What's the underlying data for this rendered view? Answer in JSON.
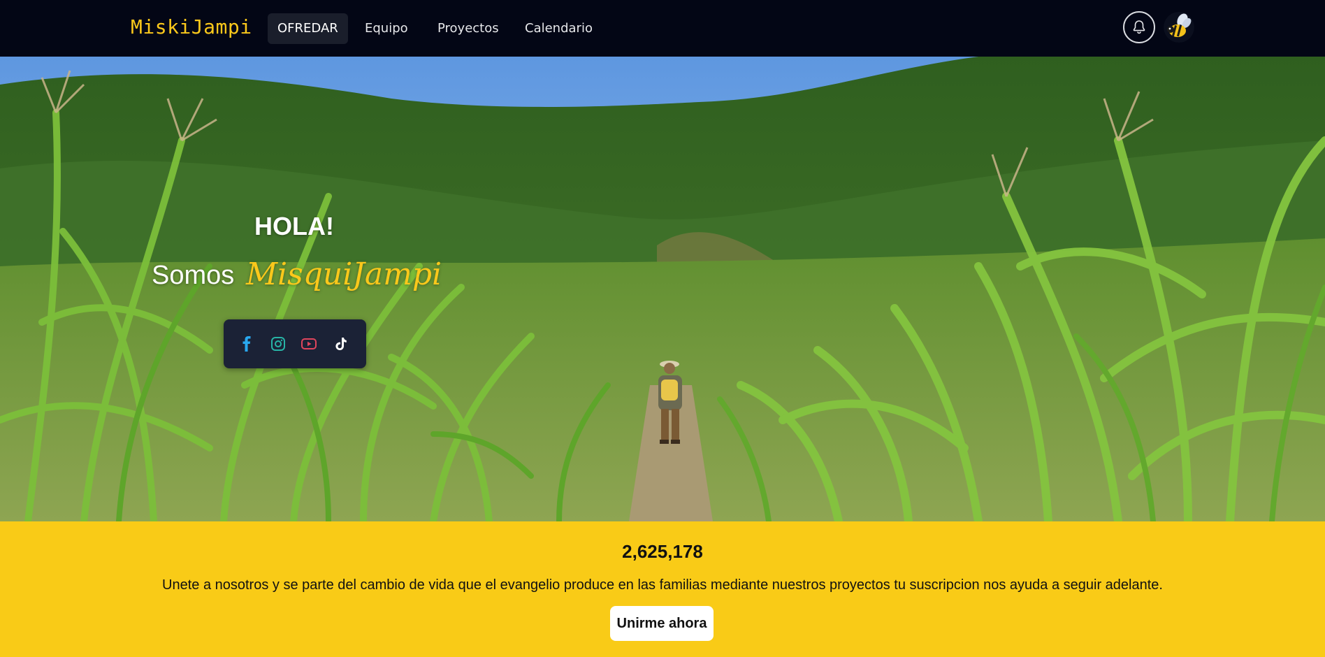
{
  "navbar": {
    "brand": "MiskiJampi",
    "links": [
      {
        "label": "OFREDAR",
        "active": true
      },
      {
        "label": "Equipo",
        "active": false
      },
      {
        "label": "Proyectos",
        "active": false
      },
      {
        "label": "Calendario",
        "active": false
      }
    ],
    "icons": {
      "notifications": "bell-icon",
      "profile": "bee-avatar"
    }
  },
  "hero": {
    "greeting": "HOLA!",
    "we_are": "Somos",
    "brand_script": "MisquiJampi",
    "social": [
      "facebook-icon",
      "instagram-icon",
      "youtube-icon",
      "tiktok-icon"
    ]
  },
  "cta": {
    "counter": "2,625,178",
    "message": "Unete a nosotros y se parte del cambio de vida que el evangelio produce en las familias mediante nuestros proyectos tu suscripcion nos ayuda a seguir adelante.",
    "button": "Unirme ahora"
  },
  "colors": {
    "nav_bg": "#030615",
    "accent": "#fbc81b",
    "cta_bg": "#f9cb17",
    "social_box": "#1b2236"
  }
}
